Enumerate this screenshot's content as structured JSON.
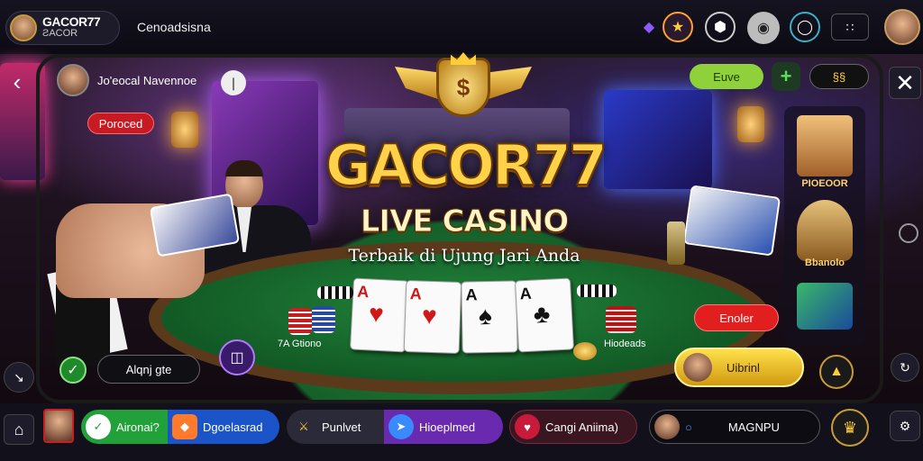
{
  "header": {
    "brand_name": "GACOR77",
    "brand_sub": "ƧACOR",
    "link": "Cenoadsisna",
    "icons": [
      "tag-icon",
      "coin-icon",
      "badge-icon",
      "chat-icon",
      "gift-icon",
      "menu-icon",
      "profile-icon"
    ]
  },
  "scene": {
    "host_name": "Jo'eocal Navennoe",
    "host_badge": "Poroced",
    "logo_mark": "$",
    "title": "GACOR77",
    "subtitle": "LIVE CASINO",
    "tagline": "Terbaik di Ujung Jari Anda",
    "live_btn": "Euve",
    "plus_btn": "+",
    "top_right_pill": "§§",
    "chip_label_left": "7A Gtiono",
    "chip_label_right": "Hiodeads",
    "cancel_btn": "Enoler",
    "ultimate_btn": "Uibrinl",
    "input_label": "Alqnj gte",
    "right_cards": [
      {
        "label": "PIOEOOR"
      },
      {
        "label": "Bbanolo"
      }
    ],
    "cards": [
      {
        "rank": "A",
        "suit": "♥",
        "color": "red"
      },
      {
        "rank": "A",
        "suit": "♥",
        "color": "red"
      },
      {
        "rank": "A",
        "suit": "♠",
        "color": "black"
      },
      {
        "rank": "A",
        "suit": "♣",
        "color": "black"
      }
    ]
  },
  "bottom": {
    "items": [
      {
        "label": "Aironai?"
      },
      {
        "label": "Dgoelasrad"
      },
      {
        "label": "Punlvet"
      },
      {
        "label": "Hioeplmed"
      },
      {
        "label": "Cangi Aniima)"
      },
      {
        "label": "MAGNPU"
      }
    ]
  },
  "colors": {
    "accent_gold": "#ffd24a",
    "live_green": "#8ed13a",
    "cancel_red": "#e21f1f",
    "table_green": "#1f7a36"
  }
}
